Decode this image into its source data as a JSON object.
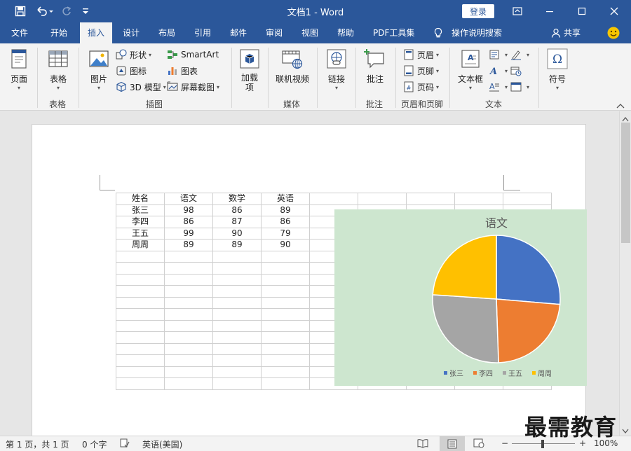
{
  "titlebar": {
    "doc_title": "文档1  -  Word",
    "login_label": "登录"
  },
  "tabs": [
    "文件",
    "开始",
    "插入",
    "设计",
    "布局",
    "引用",
    "邮件",
    "审阅",
    "视图",
    "帮助",
    "PDF工具集",
    "操作说明搜索",
    "共享"
  ],
  "ribbon": {
    "page": "页面",
    "table": "表格",
    "picture": "图片",
    "shapes": "形状",
    "icons": "图标",
    "model3d": "3D 模型",
    "smartart": "SmartArt",
    "chart": "图表",
    "screenshot": "屏幕截图",
    "addin": "加载\n项",
    "online_video": "联机视频",
    "link": "链接",
    "comment": "批注",
    "header": "页眉",
    "footer": "页脚",
    "page_number": "页码",
    "textbox": "文本框",
    "symbol": "符号",
    "groups": [
      "表格",
      "插图",
      "媒体",
      "批注",
      "页眉和页脚",
      "文本"
    ]
  },
  "table": {
    "header": [
      "姓名",
      "语文",
      "数学",
      "英语"
    ],
    "rows": [
      [
        "张三",
        "98",
        "86",
        "89"
      ],
      [
        "李四",
        "86",
        "87",
        "86"
      ],
      [
        "王五",
        "99",
        "90",
        "79"
      ],
      [
        "周周",
        "89",
        "89",
        "90"
      ]
    ]
  },
  "chart_data": {
    "type": "pie",
    "title": "语文",
    "categories": [
      "张三",
      "李四",
      "王五",
      "周周"
    ],
    "values": [
      98,
      86,
      99,
      89
    ],
    "colors": [
      "#4472c4",
      "#ed7d31",
      "#a5a5a5",
      "#ffc000"
    ],
    "legend": "bottom"
  },
  "statusbar": {
    "page_info": "第 1 页，共 1 页",
    "word_count": "0 个字",
    "language": "英语(美国)",
    "zoom": "100%"
  },
  "watermark": "最需教育"
}
